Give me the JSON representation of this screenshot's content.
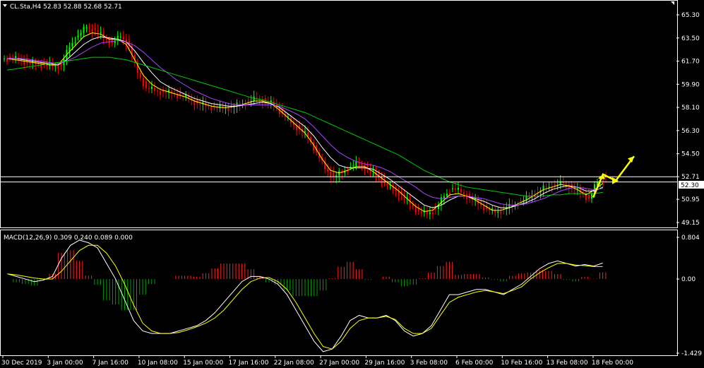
{
  "header": {
    "symbol_line": "CL.Sta,H4  52.83 52.88 52.68 52.71",
    "macd_line": "MACD(12,26,9) 0.309 0.240 0.089 0.000",
    "current_price_label": "52.30",
    "upper_line_label": "52.71"
  },
  "colors": {
    "background": "#000000",
    "frame": "#ffffff",
    "bull_candle": "#00ff00",
    "bear_candle": "#ff0000",
    "ma_fast": "#ffff00",
    "ma_mid": "#ffffff",
    "ma_slow": "#aa44ff",
    "ma_long": "#00cc00",
    "hist_up": "#ff2020",
    "hist_down": "#00a000",
    "macd_line": "#ffffff",
    "signal_line": "#ffff00",
    "forecast_arrow": "#ffff00"
  },
  "chart_data": [
    {
      "type": "line",
      "title": "CL.Sta,H4",
      "description_series": "price candles with moving averages",
      "ylim": [
        49.15,
        65.3
      ],
      "y_ticks": [
        "65.30",
        "63.50",
        "61.70",
        "59.90",
        "58.10",
        "56.30",
        "54.50",
        "52.71",
        "50.95",
        "49.15"
      ],
      "x_ticks": [
        "30 Dec 2019",
        "3 Jan 00:00",
        "7 Jan 16:00",
        "10 Jan 08:00",
        "15 Jan 00:00",
        "17 Jan 16:00",
        "22 Jan 08:00",
        "27 Jan 00:00",
        "29 Jan 16:00",
        "3 Feb 08:00",
        "6 Feb 00:00",
        "10 Feb 16:00",
        "13 Feb 08:00",
        "18 Feb 00:00"
      ],
      "horizontal_lines": [
        52.71,
        52.3
      ],
      "series": [
        {
          "name": "close",
          "values": [
            61.9,
            61.8,
            61.6,
            61.5,
            61.4,
            61.3,
            61.4,
            62.8,
            63.7,
            64.3,
            64.1,
            63.5,
            63.1,
            63.6,
            62.9,
            60.8,
            59.6,
            59.4,
            59.3,
            59.2,
            59.0,
            58.8,
            58.4,
            58.2,
            58.1,
            58.0,
            58.1,
            58.3,
            58.5,
            58.8,
            58.6,
            58.3,
            57.6,
            56.9,
            56.4,
            55.8,
            54.6,
            53.3,
            52.7,
            53.0,
            53.5,
            53.7,
            53.4,
            52.8,
            52.2,
            51.7,
            51.3,
            50.6,
            50.0,
            49.8,
            50.2,
            51.2,
            51.8,
            51.5,
            51.1,
            50.6,
            50.2,
            49.9,
            50.2,
            50.4,
            50.8,
            51.1,
            51.5,
            51.9,
            52.0,
            52.2,
            51.9,
            51.5,
            51.0,
            52.3,
            52.71
          ]
        },
        {
          "name": "ma_fast",
          "values": [
            61.9,
            61.8,
            61.7,
            61.6,
            61.5,
            61.4,
            61.4,
            62.2,
            62.9,
            63.6,
            63.9,
            63.8,
            63.4,
            63.4,
            63.0,
            61.8,
            60.6,
            59.9,
            59.5,
            59.3,
            59.1,
            58.9,
            58.6,
            58.4,
            58.2,
            58.1,
            58.1,
            58.2,
            58.4,
            58.6,
            58.6,
            58.4,
            57.9,
            57.3,
            56.7,
            56.1,
            55.2,
            54.1,
            53.2,
            53.0,
            53.2,
            53.5,
            53.5,
            53.1,
            52.6,
            52.1,
            51.6,
            51.0,
            50.4,
            50.0,
            50.1,
            50.7,
            51.3,
            51.4,
            51.2,
            50.9,
            50.5,
            50.1,
            50.1,
            50.3,
            50.6,
            50.9,
            51.3,
            51.7,
            51.9,
            52.1,
            52.0,
            51.7,
            51.3,
            51.7,
            52.2
          ]
        },
        {
          "name": "ma_mid",
          "values": [
            61.9,
            61.9,
            61.8,
            61.7,
            61.6,
            61.5,
            61.4,
            61.8,
            62.4,
            63.0,
            63.4,
            63.6,
            63.5,
            63.4,
            63.2,
            62.5,
            61.6,
            60.8,
            60.1,
            59.7,
            59.4,
            59.1,
            58.8,
            58.6,
            58.4,
            58.3,
            58.2,
            58.2,
            58.3,
            58.4,
            58.5,
            58.4,
            58.1,
            57.6,
            57.1,
            56.6,
            55.9,
            55.0,
            54.2,
            53.6,
            53.4,
            53.4,
            53.4,
            53.3,
            52.9,
            52.5,
            52.0,
            51.5,
            51.0,
            50.5,
            50.3,
            50.5,
            50.9,
            51.2,
            51.2,
            51.0,
            50.8,
            50.5,
            50.3,
            50.3,
            50.5,
            50.7,
            51.0,
            51.4,
            51.7,
            51.9,
            52.0,
            51.9,
            51.6,
            51.6,
            51.9
          ]
        },
        {
          "name": "ma_slow",
          "values": [
            61.9,
            61.9,
            61.9,
            61.8,
            61.7,
            61.6,
            61.5,
            61.7,
            62.0,
            62.4,
            62.8,
            63.1,
            63.2,
            63.3,
            63.2,
            62.9,
            62.4,
            61.8,
            61.2,
            60.7,
            60.2,
            59.8,
            59.4,
            59.1,
            58.8,
            58.6,
            58.4,
            58.3,
            58.3,
            58.3,
            58.3,
            58.3,
            58.2,
            57.9,
            57.6,
            57.2,
            56.6,
            55.9,
            55.2,
            54.6,
            54.2,
            53.9,
            53.7,
            53.6,
            53.4,
            53.1,
            52.7,
            52.3,
            51.9,
            51.4,
            51.1,
            51.0,
            51.1,
            51.2,
            51.2,
            51.1,
            51.0,
            50.8,
            50.6,
            50.5,
            50.5,
            50.6,
            50.8,
            51.0,
            51.3,
            51.6,
            51.8,
            51.9,
            51.8,
            51.7,
            51.8
          ]
        },
        {
          "name": "ma_long",
          "values": [
            61.0,
            61.1,
            61.2,
            61.3,
            61.4,
            61.5,
            61.6,
            61.7,
            61.8,
            61.9,
            62.0,
            62.0,
            62.0,
            61.9,
            61.8,
            61.6,
            61.4,
            61.2,
            61.0,
            60.8,
            60.6,
            60.4,
            60.2,
            60.0,
            59.8,
            59.6,
            59.4,
            59.2,
            59.0,
            58.8,
            58.7,
            58.5,
            58.3,
            58.1,
            57.9,
            57.7,
            57.4,
            57.1,
            56.8,
            56.5,
            56.2,
            55.9,
            55.6,
            55.3,
            55.0,
            54.7,
            54.4,
            54.0,
            53.6,
            53.2,
            52.9,
            52.6,
            52.3,
            52.1,
            51.9,
            51.8,
            51.7,
            51.6,
            51.5,
            51.4,
            51.3,
            51.2,
            51.2,
            51.2,
            51.3,
            51.3,
            51.4,
            51.4,
            51.4,
            51.4,
            51.5
          ]
        }
      ]
    },
    {
      "type": "line",
      "title": "MACD(12,26,9)",
      "ylim": [
        -1.429,
        0.804
      ],
      "y_ticks": [
        "0.804",
        "0.00",
        "-1.429"
      ],
      "series": [
        {
          "name": "macd",
          "values": [
            0.1,
            0.05,
            0.0,
            -0.05,
            -0.02,
            0.05,
            0.4,
            0.65,
            0.75,
            0.7,
            0.6,
            0.3,
            0.0,
            -0.4,
            -0.8,
            -1.0,
            -1.05,
            -1.05,
            -1.05,
            -1.0,
            -0.95,
            -0.9,
            -0.8,
            -0.65,
            -0.45,
            -0.25,
            -0.05,
            0.05,
            0.05,
            0.0,
            -0.1,
            -0.3,
            -0.6,
            -0.9,
            -1.2,
            -1.4,
            -1.35,
            -1.1,
            -0.8,
            -0.7,
            -0.75,
            -0.75,
            -0.7,
            -0.8,
            -1.0,
            -1.1,
            -1.05,
            -0.9,
            -0.6,
            -0.3,
            -0.3,
            -0.25,
            -0.2,
            -0.2,
            -0.25,
            -0.3,
            -0.2,
            -0.1,
            0.05,
            0.2,
            0.3,
            0.35,
            0.3,
            0.25,
            0.28,
            0.25,
            0.309
          ]
        },
        {
          "name": "signal",
          "values": [
            0.1,
            0.08,
            0.05,
            0.02,
            0.0,
            0.0,
            0.15,
            0.35,
            0.55,
            0.65,
            0.65,
            0.5,
            0.25,
            -0.1,
            -0.5,
            -0.85,
            -1.0,
            -1.05,
            -1.05,
            -1.03,
            -0.98,
            -0.92,
            -0.85,
            -0.75,
            -0.6,
            -0.4,
            -0.2,
            -0.05,
            0.02,
            0.03,
            -0.05,
            -0.2,
            -0.45,
            -0.75,
            -1.05,
            -1.3,
            -1.35,
            -1.2,
            -0.95,
            -0.8,
            -0.75,
            -0.75,
            -0.72,
            -0.78,
            -0.95,
            -1.05,
            -1.05,
            -0.95,
            -0.7,
            -0.45,
            -0.35,
            -0.3,
            -0.25,
            -0.22,
            -0.25,
            -0.28,
            -0.22,
            -0.15,
            0.0,
            0.12,
            0.22,
            0.3,
            0.3,
            0.27,
            0.26,
            0.24,
            0.24
          ]
        }
      ]
    }
  ]
}
